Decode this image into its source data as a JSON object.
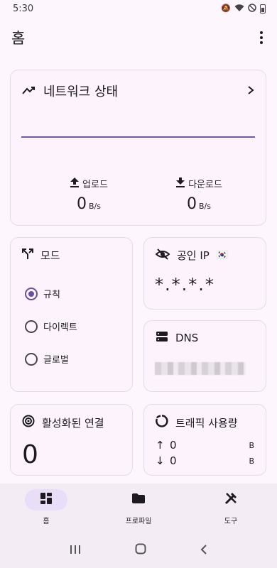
{
  "status": {
    "time": "5:30"
  },
  "appbar": {
    "title": "홈"
  },
  "network": {
    "title": "네트워크 상태",
    "upload_label": "업로드",
    "upload_value": "0",
    "upload_unit": "B/s",
    "download_label": "다운로드",
    "download_value": "0",
    "download_unit": "B/s"
  },
  "mode": {
    "title": "모드",
    "options": [
      "규칙",
      "다이렉트",
      "글로벌"
    ],
    "selected": "규칙"
  },
  "ip": {
    "title": "공인 IP",
    "flag": "🇰🇷",
    "value": "*.*.*.*"
  },
  "dns": {
    "title": "DNS"
  },
  "connections": {
    "title": "활성화된 연결",
    "value": "0"
  },
  "traffic": {
    "title": "트래픽 사용량",
    "up_arrow": "↑",
    "up_value": "0",
    "up_unit": "B",
    "down_arrow": "↓",
    "down_value": "0",
    "down_unit": "B"
  },
  "nav": {
    "items": [
      {
        "label": "홈",
        "icon": "dashboard-icon"
      },
      {
        "label": "프로파일",
        "icon": "folder-icon"
      },
      {
        "label": "도구",
        "icon": "tools-icon"
      }
    ],
    "active": "홈"
  },
  "colors": {
    "accent": "#6750a4",
    "line": "#6b5aa6",
    "surface": "#fdf7fd"
  }
}
